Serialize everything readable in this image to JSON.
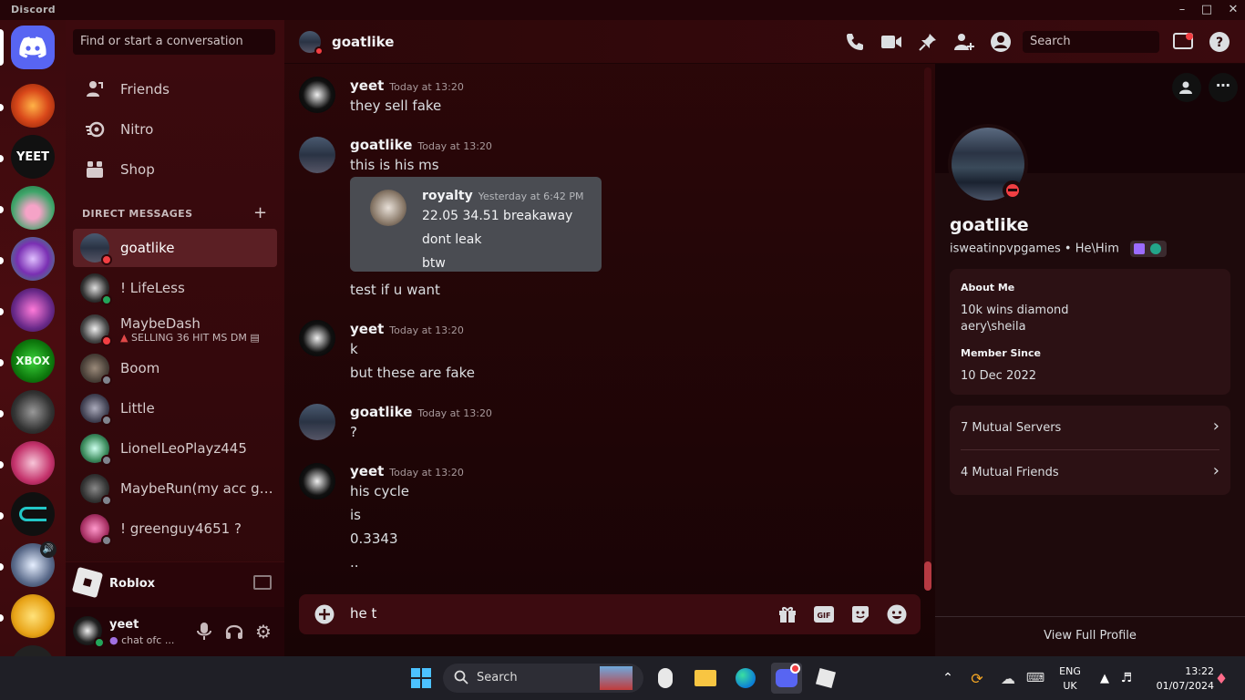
{
  "titlebar": {
    "app_name": "Discord"
  },
  "servers": [
    {
      "name": "home",
      "color": "#5865f2"
    },
    {
      "name": "server-fire",
      "color": "#d9481a"
    },
    {
      "name": "server-yeet",
      "color": "#111111",
      "label": "YEET"
    },
    {
      "name": "server-kirby",
      "color": "#3fa56a"
    },
    {
      "name": "server-purple-badge",
      "color": "#7a2fb3"
    },
    {
      "name": "server-pink-creature",
      "color": "#6a2a8a"
    },
    {
      "name": "server-xbox",
      "color": "#0e7a0d",
      "label": "XBOX"
    },
    {
      "name": "server-dark-figure",
      "color": "#333333"
    },
    {
      "name": "server-pink-anime",
      "color": "#c4326b"
    },
    {
      "name": "server-teal-logo",
      "color": "#101010"
    },
    {
      "name": "server-cloud",
      "color": "#5a6a8a"
    },
    {
      "name": "server-orange-face",
      "color": "#e8a317"
    }
  ],
  "sidebar": {
    "search_placeholder": "Find or start a conversation",
    "nav": [
      {
        "label": "Friends"
      },
      {
        "label": "Nitro"
      },
      {
        "label": "Shop"
      }
    ],
    "dm_header": "DIRECT MESSAGES",
    "dm_add": "+",
    "dms": [
      {
        "name": "goatlike",
        "status": "dnd",
        "active": true
      },
      {
        "name": "! LifeLess",
        "status": "on"
      },
      {
        "name": "MaybeDash",
        "status": "dnd",
        "sub": "SELLING 36 HIT MS DM"
      },
      {
        "name": "Boom",
        "status": "off"
      },
      {
        "name": "Little",
        "status": "off"
      },
      {
        "name": "LionelLeoPlayz445",
        "status": "off"
      },
      {
        "name": "MaybeRun(my acc got...",
        "status": "off"
      },
      {
        "name": "! greenguy4651 ?",
        "status": "off"
      }
    ]
  },
  "activity": {
    "game": "Roblox"
  },
  "user": {
    "name": "yeet",
    "status": "chat ofc ..."
  },
  "chat": {
    "channel": "goatlike",
    "search_placeholder": "Search",
    "messages": [
      {
        "author": "yeet",
        "time": "Today at 13:20",
        "lines": [
          "they sell fake"
        ]
      },
      {
        "author": "goatlike",
        "time": "Today at 13:20",
        "lines": [
          "this is his ms"
        ]
      },
      {
        "author": "goatlike",
        "time": "",
        "lines": [
          "test if u want"
        ]
      },
      {
        "author": "yeet",
        "time": "Today at 13:20",
        "lines": [
          "k",
          "but these are fake"
        ]
      },
      {
        "author": "goatlike",
        "time": "Today at 13:20",
        "lines": [
          "?"
        ]
      },
      {
        "author": "yeet",
        "time": "Today at 13:20",
        "lines": [
          "his cycle",
          "is",
          "0.3343",
          ".."
        ]
      }
    ],
    "quote": {
      "author": "royalty",
      "time": "Yesterday at 6:42 PM",
      "lines": [
        "22.05 34.51 breakaway",
        "dont leak",
        "btw"
      ]
    },
    "composer_value": "he t"
  },
  "profile": {
    "name": "goatlike",
    "username": "isweatinpvpgames",
    "pronouns": "He\\Him",
    "about_title": "About Me",
    "about_lines": [
      "10k wins diamond",
      "aery\\sheila"
    ],
    "member_title": "Member Since",
    "member_date": "10 Dec 2022",
    "mutual_servers": "7 Mutual Servers",
    "mutual_friends": "4 Mutual Friends",
    "view_full": "View Full Profile"
  },
  "taskbar": {
    "search": "Search",
    "lang": "ENG",
    "region": "UK",
    "time": "13:22",
    "date": "01/07/2024"
  },
  "colors": {
    "accent": "#5865f2",
    "dnd": "#f23f43",
    "online": "#23a55a",
    "offline": "#80848e"
  }
}
